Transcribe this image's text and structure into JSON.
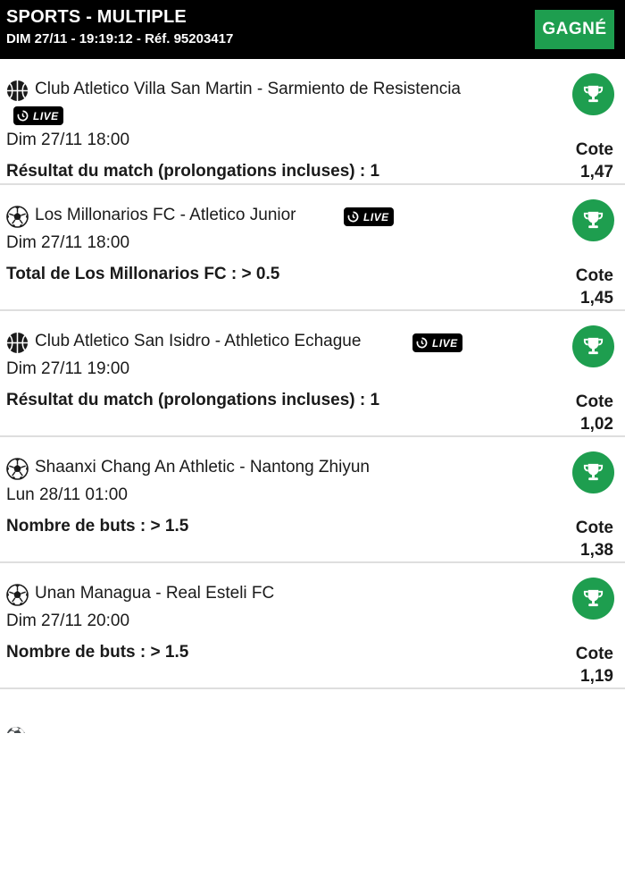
{
  "header": {
    "title": "SPORTS - MULTIPLE",
    "subtitle": "DIM 27/11 - 19:19:12 - Réf. 95203417",
    "status": "GAGNÉ"
  },
  "colors": {
    "header_bg": "#000000",
    "win_green": "#1e9e4f",
    "divider": "#dedede"
  },
  "bets": [
    {
      "sport_icon": "basketball-icon",
      "match": "Club Atletico Villa San Martin - Sarmiento de Resistencia",
      "live": "LIVE",
      "date": "Dim 27/11 18:00",
      "selection": "Résultat du match (prolongations incluses) : 1",
      "cote_label": "Cote",
      "cote": "1,47",
      "result_icon": "trophy-icon"
    },
    {
      "sport_icon": "football-icon",
      "match": "Los Millonarios FC - Atletico Junior",
      "live": "LIVE",
      "date": "Dim 27/11 18:00",
      "selection": "Total de Los Millonarios FC : > 0.5",
      "cote_label": "Cote",
      "cote": "1,45",
      "result_icon": "trophy-icon"
    },
    {
      "sport_icon": "basketball-icon",
      "match": "Club Atletico San Isidro - Athletico Echague",
      "live": "LIVE",
      "date": "Dim 27/11 19:00",
      "selection": "Résultat du match (prolongations incluses) : 1",
      "cote_label": "Cote",
      "cote": "1,02",
      "result_icon": "trophy-icon"
    },
    {
      "sport_icon": "football-icon",
      "match": "Shaanxi Chang An Athletic - Nantong Zhiyun",
      "live": "",
      "date": "Lun 28/11 01:00",
      "selection": "Nombre de buts : > 1.5",
      "cote_label": "Cote",
      "cote": "1,38",
      "result_icon": "trophy-icon"
    },
    {
      "sport_icon": "football-icon",
      "match": "Unan Managua - Real Esteli FC",
      "live": "",
      "date": "Dim 27/11 20:00",
      "selection": "Nombre de buts : > 1.5",
      "cote_label": "Cote",
      "cote": "1,19",
      "result_icon": "trophy-icon"
    }
  ]
}
